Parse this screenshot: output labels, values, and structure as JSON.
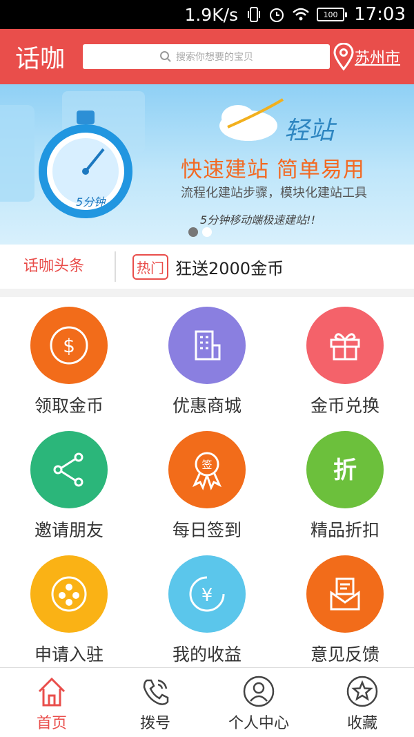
{
  "status_bar": {
    "speed": "1.9K/s",
    "battery": "100",
    "time": "17:03"
  },
  "header": {
    "logo": "话咖",
    "search_placeholder": "搜索你想要的宝贝",
    "city": "苏州市"
  },
  "banner": {
    "brand": "轻站",
    "headline": "快速建站  简单易用",
    "subtitle": "流程化建站步骤，模块化建站工具",
    "tagline": "5分钟移动端极速建站!!",
    "stopwatch_label": "5分钟",
    "active_slide": 1,
    "slide_count": 2
  },
  "headline_bar": {
    "label": "话咖头条",
    "badge": "热门",
    "text": "狂送2000金币"
  },
  "grid": {
    "items": [
      {
        "label": "领取金币",
        "color": "#f26c1a",
        "icon": "coin-dollar-icon"
      },
      {
        "label": "优惠商城",
        "color": "#8a7fe0",
        "icon": "building-icon"
      },
      {
        "label": "金币兑换",
        "color": "#f4626a",
        "icon": "gift-icon"
      },
      {
        "label": "邀请朋友",
        "color": "#2bb67a",
        "icon": "share-icon"
      },
      {
        "label": "每日签到",
        "color": "#f26c1a",
        "icon": "sign-in-badge-icon"
      },
      {
        "label": "精品折扣",
        "color": "#6cc03c",
        "icon": "discount-icon"
      },
      {
        "label": "申请入驻",
        "color": "#fab215",
        "icon": "apply-settle-icon"
      },
      {
        "label": "我的收益",
        "color": "#5bc6eb",
        "icon": "yuan-earnings-icon"
      },
      {
        "label": "意见反馈",
        "color": "#f26c1a",
        "icon": "feedback-mail-icon"
      }
    ]
  },
  "nav": {
    "items": [
      {
        "label": "首页",
        "icon": "home-icon",
        "active": true
      },
      {
        "label": "拨号",
        "icon": "phone-icon",
        "active": false
      },
      {
        "label": "个人中心",
        "icon": "user-icon",
        "active": false
      },
      {
        "label": "收藏",
        "icon": "star-icon",
        "active": false
      }
    ]
  },
  "colors": {
    "brand_red": "#e94e4b"
  }
}
